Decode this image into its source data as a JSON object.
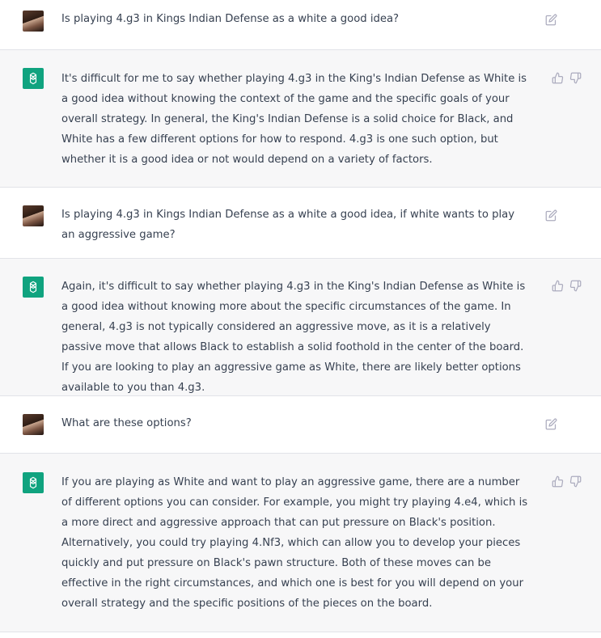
{
  "messages": [
    {
      "role": "user",
      "text": "Is playing 4.g3 in Kings Indian Defense as a white a good idea?"
    },
    {
      "role": "assistant",
      "text": "It's difficult for me to say whether playing 4.g3 in the King's Indian Defense as White is a good idea without knowing the context of the game and the specific goals of your overall strategy. In general, the King's Indian Defense is a solid choice for Black, and White has a few different options for how to respond. 4.g3 is one such option, but whether it is a good idea or not would depend on a variety of factors."
    },
    {
      "role": "user",
      "text": "Is playing 4.g3 in Kings Indian Defense as a white a good idea, if white wants to play an aggressive game?"
    },
    {
      "role": "assistant",
      "text": "Again, it's difficult to say whether playing 4.g3 in the King's Indian Defense as White is a good idea without knowing more about the specific circumstances of the game. In general, 4.g3 is not typically considered an aggressive move, as it is a relatively passive move that allows Black to establish a solid foothold in the center of the board. If you are looking to play an aggressive game as White, there are likely better options available to you than 4.g3."
    },
    {
      "role": "user",
      "text": "What are these options?"
    },
    {
      "role": "assistant",
      "text": "If you are playing as White and want to play an aggressive game, there are a number of different options you can consider. For example, you might try playing 4.e4, which is a more direct and aggressive approach that can put pressure on Black's position. Alternatively, you could try playing 4.Nf3, which can allow you to develop your pieces quickly and put pressure on Black's pawn structure. Both of these moves can be effective in the right circumstances, and which one is best for you will depend on your overall strategy and the specific positions of the pieces on the board."
    }
  ],
  "icons": {
    "edit": "edit-icon",
    "thumbs_up": "thumbs-up-icon",
    "thumbs_down": "thumbs-down-icon",
    "assistant_logo": "openai-logo-icon"
  },
  "colors": {
    "assistant_bg": "#f7f7f8",
    "user_bg": "#ffffff",
    "brand_green": "#10a37f",
    "text": "#374151",
    "icon": "#acacbe",
    "divider": "#e2e3e8"
  }
}
